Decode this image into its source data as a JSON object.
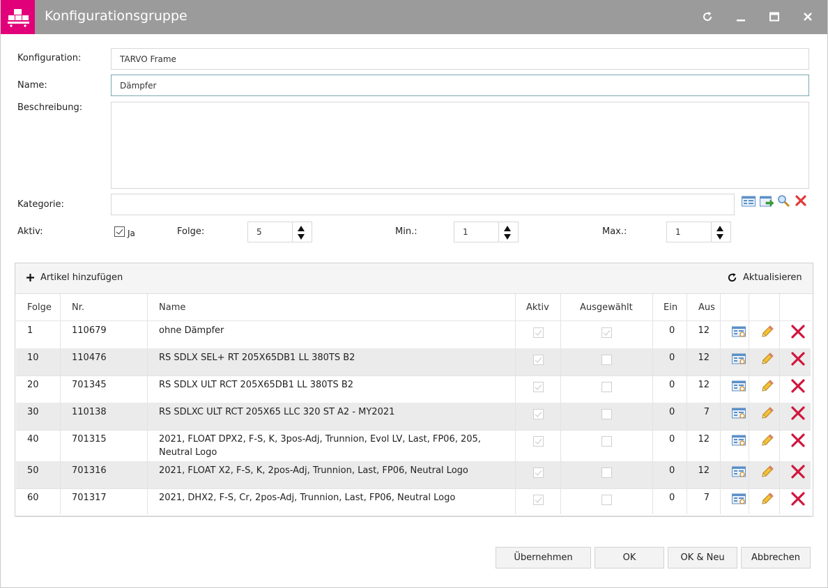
{
  "window": {
    "title": "Konfigurationsgruppe"
  },
  "form": {
    "konfiguration_label": "Konfiguration:",
    "konfiguration_value": "TARVO Frame",
    "name_label": "Name:",
    "name_value": "Dämpfer",
    "beschreibung_label": "Beschreibung:",
    "beschreibung_value": "",
    "kategorie_label": "Kategorie:",
    "kategorie_value": "",
    "aktiv_label": "Aktiv:",
    "aktiv_checked": true,
    "aktiv_text": "Ja",
    "folge_label": "Folge:",
    "folge_value": "5",
    "min_label": "Min.:",
    "min_value": "1",
    "max_label": "Max.:",
    "max_value": "1"
  },
  "grid": {
    "add_label": "Artikel hinzufügen",
    "refresh_label": "Aktualisieren",
    "columns": {
      "folge": "Folge",
      "nr": "Nr.",
      "name": "Name",
      "aktiv": "Aktiv",
      "ausgewaehlt": "Ausgewählt",
      "ein": "Ein",
      "aus": "Aus"
    },
    "rows": [
      {
        "folge": "1",
        "nr": "110679",
        "name": "ohne Dämpfer",
        "name2": "",
        "aktiv": true,
        "ausgewaehlt": true,
        "ein": "0",
        "aus": "12"
      },
      {
        "folge": "10",
        "nr": "110476",
        "name": "RS SDLX SEL+ RT 205X65DB1 LL 380TS B2",
        "name2": "",
        "aktiv": true,
        "ausgewaehlt": false,
        "ein": "0",
        "aus": "12"
      },
      {
        "folge": "20",
        "nr": "701345",
        "name": "RS SDLX ULT RCT 205X65DB1 LL 380TS B2",
        "name2": "",
        "aktiv": true,
        "ausgewaehlt": false,
        "ein": "0",
        "aus": "12"
      },
      {
        "folge": "30",
        "nr": "110138",
        "name": "RS SDLXC ULT RCT 205X65 LLC 320 ST A2 - MY2021",
        "name2": "",
        "aktiv": true,
        "ausgewaehlt": false,
        "ein": "0",
        "aus": "7"
      },
      {
        "folge": "40",
        "nr": "701315",
        "name": "2021, FLOAT DPX2, F-S, K, 3pos-Adj, Trunnion, Evol LV, Last, FP06, 205,",
        "name2": "Neutral Logo",
        "aktiv": true,
        "ausgewaehlt": false,
        "ein": "0",
        "aus": "12"
      },
      {
        "folge": "50",
        "nr": "701316",
        "name": "2021, FLOAT X2, F-S, K, 2pos-Adj, Trunnion, Last, FP06, Neutral Logo",
        "name2": "",
        "aktiv": true,
        "ausgewaehlt": false,
        "ein": "0",
        "aus": "12"
      },
      {
        "folge": "60",
        "nr": "701317",
        "name": "2021, DHX2, F-S, Cr, 2pos-Adj, Trunnion, Last, FP06, Neutral Logo",
        "name2": "",
        "aktiv": true,
        "ausgewaehlt": false,
        "ein": "0",
        "aus": "7"
      }
    ]
  },
  "footer": {
    "uebernehmen": "Übernehmen",
    "ok": "OK",
    "ok_neu": "OK & Neu",
    "abbrechen": "Abbrechen"
  },
  "colors": {
    "brand": "#e2007a",
    "titlebar": "#9b9b9b",
    "delete": "#d0163e"
  }
}
